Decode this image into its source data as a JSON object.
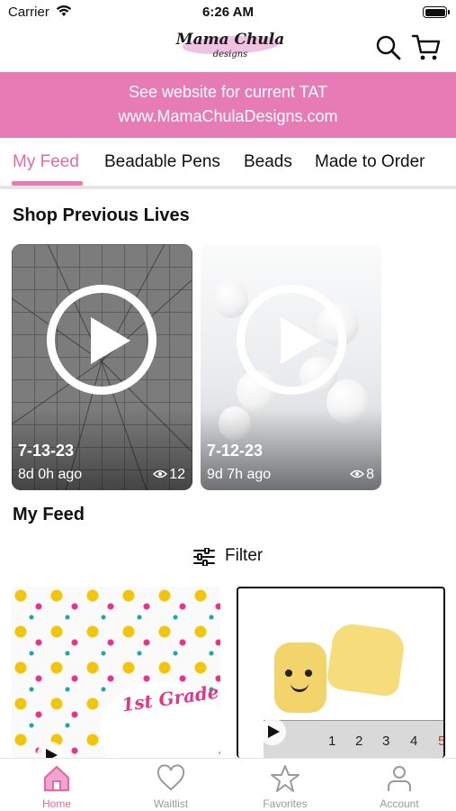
{
  "status_bar": {
    "carrier": "Carrier",
    "time": "6:26 AM"
  },
  "header": {
    "logo_name": "Mama Chula",
    "logo_sub": "designs",
    "search_icon": "search-icon",
    "cart_icon": "cart-icon"
  },
  "banner": {
    "line1": "See website for current TAT",
    "line2": "www.MamaChulaDesigns.com"
  },
  "tabs": [
    {
      "label": "My Feed",
      "active": true
    },
    {
      "label": "Beadable Pens",
      "active": false
    },
    {
      "label": "Beads",
      "active": false
    },
    {
      "label": "Made to Order",
      "active": false
    }
  ],
  "previous_lives": {
    "title": "Shop Previous Lives",
    "cards": [
      {
        "date": "7-13-23",
        "ago": "8d 0h ago",
        "views": "12"
      },
      {
        "date": "7-12-23",
        "ago": "9d 7h ago",
        "views": "8"
      }
    ]
  },
  "feed": {
    "title": "My Feed",
    "filter_label": "Filter",
    "thumb1_text": "1st Grade",
    "ruler_numbers": [
      "1",
      "2",
      "3",
      "4",
      "5"
    ]
  },
  "bottom_nav": [
    {
      "label": "Home",
      "icon": "home-icon",
      "active": true
    },
    {
      "label": "Waitlist",
      "icon": "heart-icon",
      "active": false
    },
    {
      "label": "Favorites",
      "icon": "star-icon",
      "active": false
    },
    {
      "label": "Account",
      "icon": "person-icon",
      "active": false
    }
  ],
  "colors": {
    "brand_pink": "#e77bb6",
    "active_text": "#e369a8",
    "inactive_nav": "#9a9a9a"
  }
}
